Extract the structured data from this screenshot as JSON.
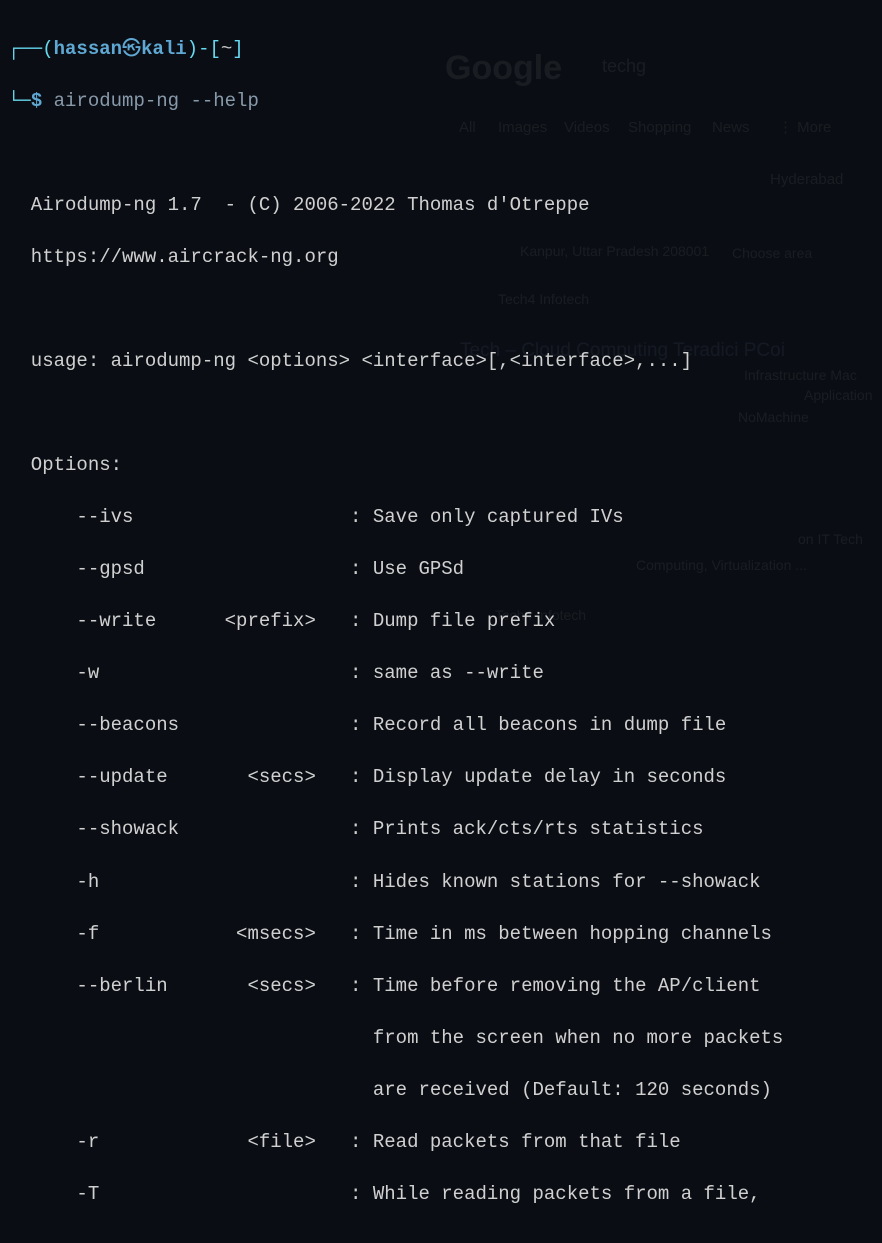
{
  "prompt": {
    "box_tl": "┌──",
    "open_paren": "(",
    "user": "hassan",
    "at": "㉿",
    "host": "kali",
    "close_paren": ")",
    "dash": "-",
    "open_bracket": "[",
    "path": "~",
    "close_bracket": "]",
    "box_bl": "└─",
    "dollar": "$",
    "command": "airodump-ng --help"
  },
  "output": {
    "blank1": " ",
    "header1": "  Airodump-ng 1.7  - (C) 2006-2022 Thomas d'Otreppe",
    "header2": "  https://www.aircrack-ng.org",
    "blank2": " ",
    "usage": "  usage: airodump-ng <options> <interface>[,<interface>,...]",
    "blank3": " ",
    "opts_hdr": "  Options:",
    "opt_ivs": "      --ivs                   : Save only captured IVs",
    "opt_gpsd": "      --gpsd                  : Use GPSd",
    "opt_write": "      --write      <prefix>   : Dump file prefix",
    "opt_w": "      -w                      : same as --write",
    "opt_beacons": "      --beacons               : Record all beacons in dump file",
    "opt_update": "      --update       <secs>   : Display update delay in seconds",
    "opt_showack": "      --showack               : Prints ack/cts/rts statistics",
    "opt_h": "      -h                      : Hides known stations for --showack",
    "opt_f": "      -f            <msecs>   : Time in ms between hopping channels",
    "opt_berlin1": "      --berlin       <secs>   : Time before removing the AP/client",
    "opt_berlin2": "                                from the screen when no more packets",
    "opt_berlin3": "                                are received (Default: 120 seconds)",
    "opt_r": "      -r             <file>   : Read packets from that file",
    "opt_T": "      -T                      : While reading packets from a file,"
  },
  "bg": {
    "google": "Google",
    "search": "techg",
    "tabs": {
      "all": "All",
      "images": "Images",
      "videos": "Videos",
      "shopping": "Shopping",
      "news": "News",
      "more": "⋮ More"
    },
    "loc1": "Hyderabad",
    "loc2": "Kanpur, Uttar Pradesh 208001",
    "choose": "Choose area",
    "result1": "Tech4 Infotech",
    "result2": "Tech – Cloud Computing Teradici PCoi",
    "snippet1": "Infrastructure Mac",
    "snippet2": "Application",
    "snippet3": "NoMachine",
    "snippet4": "on IT Tech",
    "snippet5": "Computing, Virtualization ...",
    "snippet6": "Tech4 Infotech"
  }
}
